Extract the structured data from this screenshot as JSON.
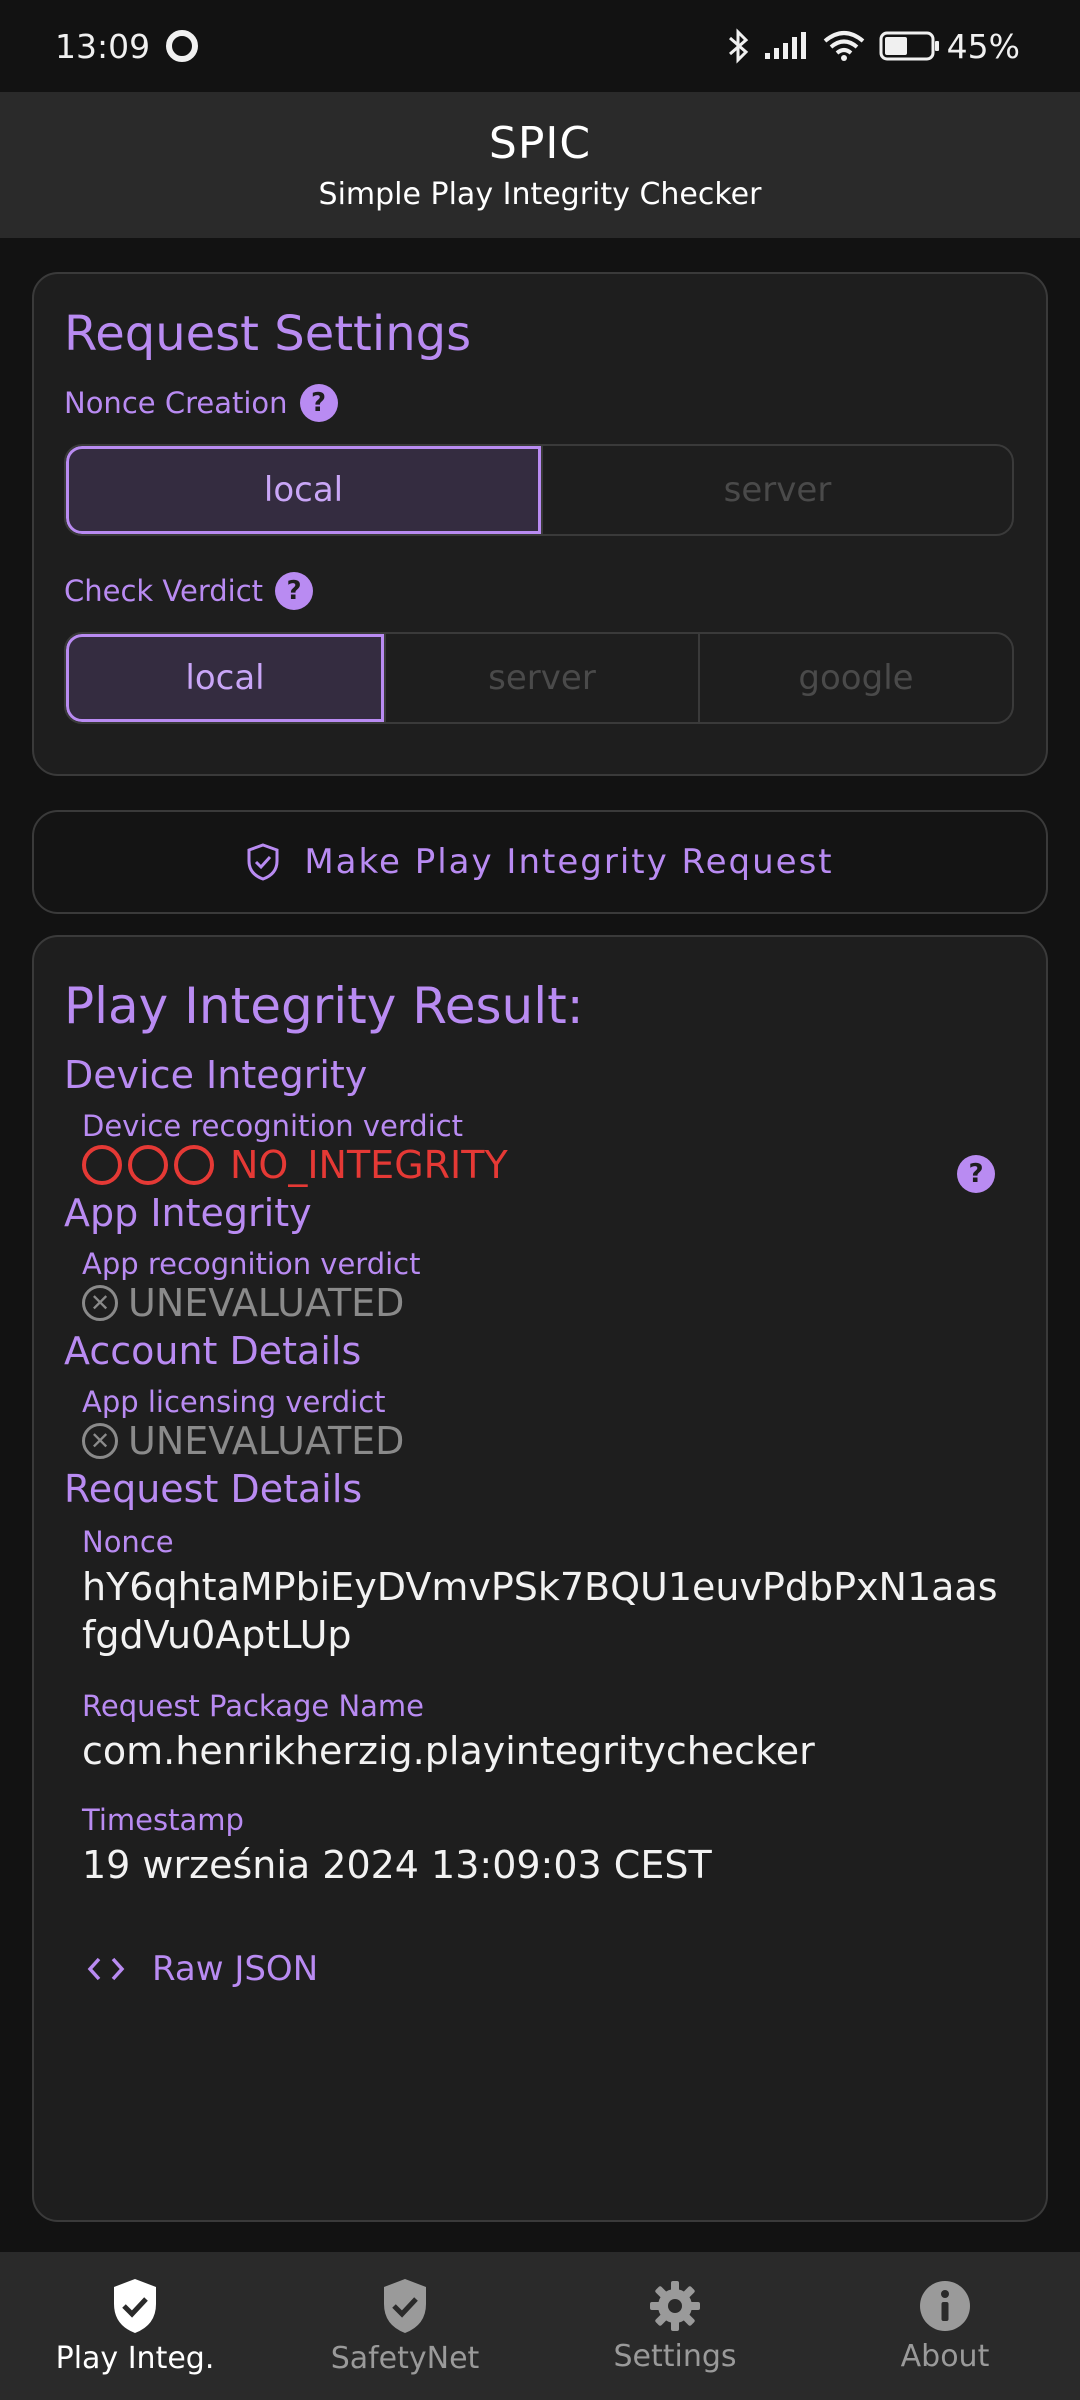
{
  "status_bar": {
    "time": "13:09",
    "battery": "45%"
  },
  "app_bar": {
    "title": "SPIC",
    "subtitle": "Simple Play Integrity Checker"
  },
  "request_settings": {
    "title": "Request Settings",
    "nonce_label": "Nonce Creation",
    "nonce_options": [
      "local",
      "server"
    ],
    "nonce_selected": "local",
    "verdict_label": "Check Verdict",
    "verdict_options": [
      "local",
      "server",
      "google"
    ],
    "verdict_selected": "local"
  },
  "request_button": {
    "label": "Make Play Integrity Request"
  },
  "result": {
    "title": "Play Integrity Result:",
    "device_integrity": {
      "title": "Device Integrity",
      "label": "Device recognition verdict",
      "value": "NO_INTEGRITY"
    },
    "app_integrity": {
      "title": "App Integrity",
      "label": "App recognition verdict",
      "value": "UNEVALUATED"
    },
    "account_details": {
      "title": "Account Details",
      "label": "App licensing verdict",
      "value": "UNEVALUATED"
    },
    "request_details": {
      "title": "Request Details",
      "nonce_label": "Nonce",
      "nonce_value": "hY6qhtaMPbiEyDVmvPSk7BQU1euvPdbPxN1aasfgdVu0AptLUp",
      "package_label": "Request Package Name",
      "package_value": "com.henrikherzig.playintegritychecker",
      "timestamp_label": "Timestamp",
      "timestamp_value": "19 września 2024 13:09:03 CEST"
    },
    "raw_json_label": "Raw JSON"
  },
  "bottom_nav": {
    "items": [
      {
        "label": "Play Integ.",
        "icon": "shield-check-icon",
        "active": true
      },
      {
        "label": "SafetyNet",
        "icon": "shield-check-icon",
        "active": false
      },
      {
        "label": "Settings",
        "icon": "gear-icon",
        "active": false
      },
      {
        "label": "About",
        "icon": "info-icon",
        "active": false
      }
    ]
  },
  "colors": {
    "accent": "#b98bf2",
    "error": "#e53935",
    "background": "#121212",
    "card": "#1e1e1e"
  }
}
